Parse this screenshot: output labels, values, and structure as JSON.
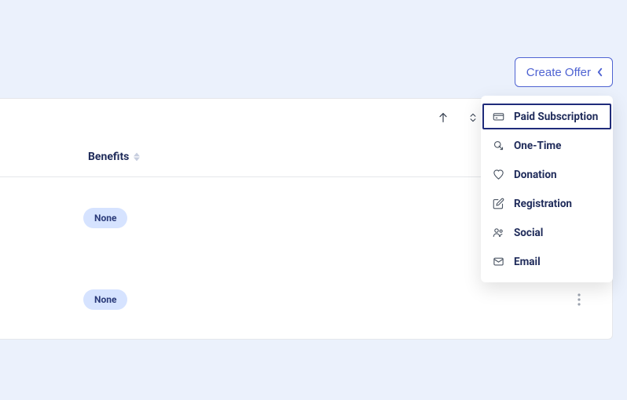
{
  "createOffer": {
    "label": "Create Offer",
    "menu": [
      {
        "label": "Paid Subscription",
        "icon": "card-icon",
        "selected": true
      },
      {
        "label": "One-Time",
        "icon": "click-icon",
        "selected": false
      },
      {
        "label": "Donation",
        "icon": "heart-icon",
        "selected": false
      },
      {
        "label": "Registration",
        "icon": "edit-icon",
        "selected": false
      },
      {
        "label": "Social",
        "icon": "people-icon",
        "selected": false
      },
      {
        "label": "Email",
        "icon": "mail-icon",
        "selected": false
      }
    ]
  },
  "table": {
    "columns": {
      "benefits": "Benefits"
    },
    "rows": [
      {
        "benefits_badge": "None"
      },
      {
        "benefits_badge": "None"
      }
    ]
  }
}
